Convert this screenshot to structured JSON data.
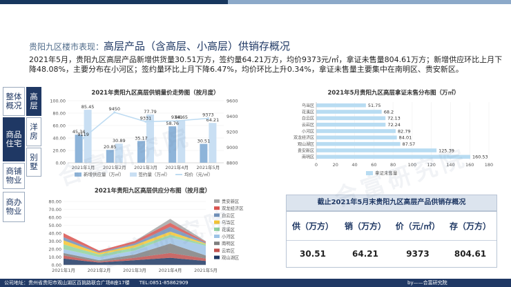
{
  "header": {
    "section": "贵阳九区楼市表现：",
    "title": "高层产品（含高层、小高层）供销存概况"
  },
  "summary": "2021年5月，贵阳九区高层产品新增供货量30.51万方，签约量64.21万方，均价9373元/㎡，拿证未售量804.61万方；新增供应环比上月下降48.08%，主要分布在小河区；签约量环比上月下降6.47%，均价环比上升0.34%，拿证未售量主要集中在南明区、贵安新区。",
  "nav": {
    "overview": "整体概况",
    "residential": "商品住宅",
    "highrise": "高层",
    "villa_house": "洋房",
    "villa": "别墅",
    "shop": "商铺物业",
    "office": "商办物业"
  },
  "watermark": "合富研究院",
  "colors": {
    "supply": "#8eb4d9",
    "signed": "#c9dff3",
    "price": "#bfdcf2",
    "inventory_bar": "#b8dcf2",
    "accent": "#1f3864"
  },
  "inventory_summary": {
    "title": "截止2021年5月末贵阳九区高层产品供销存概况",
    "headers": [
      "供（万方）",
      "销（万方）",
      "价（元/㎡）",
      "存（万方）"
    ],
    "values": [
      "30.51",
      "64.21",
      "9373",
      "804.61"
    ]
  },
  "footer": {
    "address": "公司地址：贵州省贵阳市观山湖区百挑路联合广场B座17楼　　TEL:0851-85862909",
    "by": "by——合富研究院"
  },
  "chart_data": [
    {
      "type": "bar",
      "title": "2021年贵阳九区高层供销量价走势图（按月度）",
      "categories": [
        "2021年1月",
        "2021年2月",
        "2021年3月",
        "2021年4月",
        "2021年5月"
      ],
      "series": [
        {
          "name": "新增供应量（万㎡）",
          "type": "bar",
          "values": [
            45.34,
            20.85,
            35.17,
            58.76,
            30.51
          ],
          "labels": [
            "45.34",
            "20.85",
            "35.17",
            "58.76",
            "30.51"
          ]
        },
        {
          "name": "签约量（万㎡）",
          "type": "bar",
          "values": [
            85.45,
            30.89,
            77.79,
            68.65,
            64.21
          ],
          "labels": [
            "85.45",
            "30.89",
            "77.79",
            "68.65",
            "64.21"
          ]
        },
        {
          "name": "均价（元/㎡）",
          "type": "line",
          "axis": "right",
          "values": [
            9119,
            9450,
            9331,
            9341,
            9373
          ],
          "labels": [
            "9119",
            "9450",
            "9331",
            "9341",
            "9373"
          ]
        }
      ],
      "ylim": [
        0,
        100
      ],
      "yticks": [
        "0.00",
        "20.00",
        "40.00",
        "60.00",
        "80.00",
        "100.00"
      ],
      "y2lim": [
        8800,
        9600
      ],
      "y2ticks": [
        "8800",
        "9000",
        "9200",
        "9400",
        "9600"
      ],
      "legend": "bottom"
    },
    {
      "type": "bar",
      "orientation": "horizontal",
      "title": "2021年5月贵阳九区高层拿证未售分布图（万㎡）",
      "categories": [
        "乌当区",
        "花溪区",
        "白云区",
        "云岩区",
        "小河区",
        "双龙经济区",
        "观山湖区",
        "贵安新区",
        "南明区"
      ],
      "series": [
        {
          "name": "拿证未售量",
          "values": [
            51.75,
            68.2,
            72.13,
            72.24,
            82.79,
            84.01,
            87.57,
            125.39,
            160.53
          ],
          "labels": [
            "51.75",
            "68.2",
            "72.13",
            "72.24",
            "82.79",
            "84.01",
            "87.57",
            "125.39",
            "160.53"
          ]
        }
      ],
      "xlim": [
        0,
        180
      ],
      "xticks": [
        "0",
        "20",
        "40",
        "60",
        "80",
        "100",
        "120",
        "140",
        "160",
        "180"
      ],
      "legend": "bottom"
    },
    {
      "type": "area",
      "title": "2021年贵阳九区高层供应分布图（按月度）",
      "categories": [
        "2021年1月",
        "2021年2月",
        "2021年3月",
        "2021年4月",
        "2021年5月"
      ],
      "series": [
        {
          "name": "观山湖区",
          "color": "#1f3864",
          "values": [
            8,
            3,
            6,
            9,
            5
          ]
        },
        {
          "name": "云岩区",
          "color": "#c0504d",
          "values": [
            4,
            1,
            3,
            6,
            3
          ]
        },
        {
          "name": "南明区",
          "color": "#7f7f7f",
          "values": [
            3,
            2,
            4,
            12,
            4
          ]
        },
        {
          "name": "小河区",
          "color": "#9dc3e6",
          "values": [
            5,
            4,
            5,
            8,
            12
          ]
        },
        {
          "name": "花溪区",
          "color": "#8fd19e",
          "values": [
            6,
            3,
            4,
            3,
            2
          ]
        },
        {
          "name": "乌当区",
          "color": "#f4c430",
          "values": [
            5,
            2,
            3,
            4,
            1
          ]
        },
        {
          "name": "白云区",
          "color": "#6f8fb8",
          "values": [
            4,
            1,
            2,
            6,
            1
          ]
        },
        {
          "name": "双龙经济区",
          "color": "#d9534f",
          "values": [
            5,
            2,
            3,
            5,
            1
          ]
        },
        {
          "name": "贵安新区",
          "color": "#a5a5a5",
          "values": [
            0,
            0,
            0,
            5,
            1
          ]
        }
      ],
      "ylim": [
        0,
        80
      ],
      "yticks": [
        "0.00",
        "10.00",
        "20.00",
        "30.00",
        "40.00",
        "50.00",
        "60.00",
        "70.00",
        "80.00"
      ],
      "legend": "right"
    }
  ]
}
